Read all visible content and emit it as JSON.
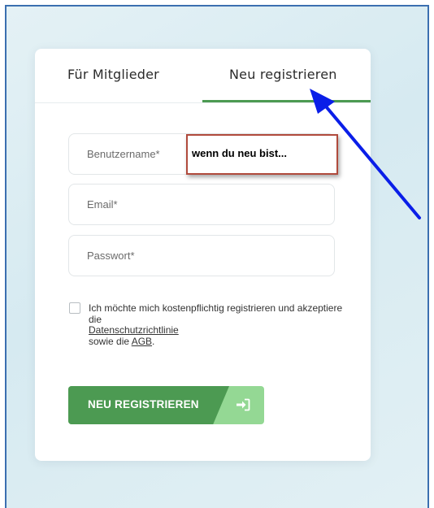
{
  "tabs": {
    "members_label": "Für Mitglieder",
    "register_label": "Neu registrieren",
    "active": "register"
  },
  "form": {
    "username_placeholder": "Benutzername*",
    "email_placeholder": "Email*",
    "password_placeholder": "Passwort*"
  },
  "consent": {
    "text_before": "Ich möchte mich kostenpflichtig registrieren und akzeptiere die",
    "privacy_link": "Datenschutzrichtlinie",
    "text_mid": "sowie die",
    "terms_link": "AGB",
    "text_end": ".",
    "checked": false
  },
  "submit": {
    "label": "NEU REGISTRIEREN",
    "icon": "sign-in-icon"
  },
  "annotation": {
    "text": "wenn du neu bist..."
  },
  "colors": {
    "accent": "#4c9a52",
    "accent_light": "#94d894",
    "annotation_border": "#b04a3c",
    "arrow": "#0a1ee8",
    "frame_border": "#3b6fb0"
  }
}
